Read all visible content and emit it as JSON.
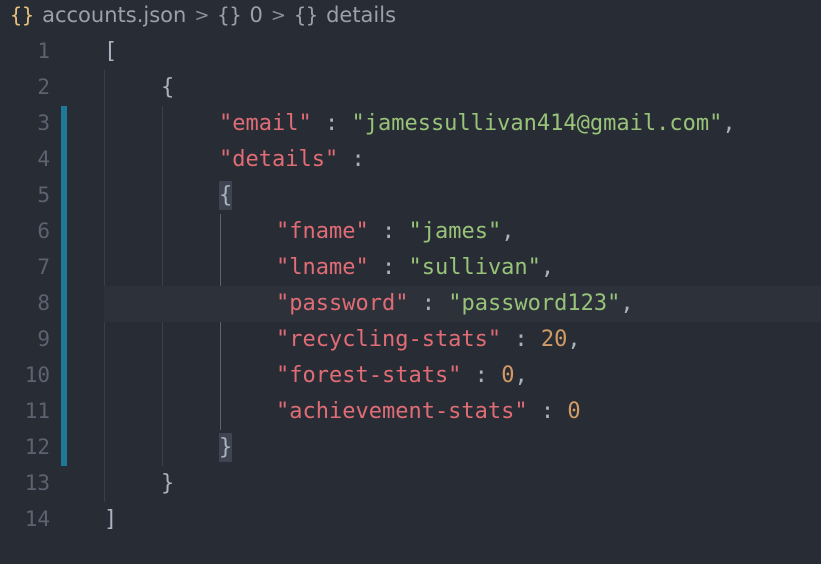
{
  "breadcrumb": {
    "file_icon": "{}",
    "file_name": "accounts.json",
    "sep1": ">",
    "seg1_icon": "{}",
    "seg1_label": "0",
    "sep2": ">",
    "seg2_icon": "{}",
    "seg2_label": "details"
  },
  "editor": {
    "lines": [
      {
        "num": "1"
      },
      {
        "num": "2"
      },
      {
        "num": "3"
      },
      {
        "num": "4"
      },
      {
        "num": "5"
      },
      {
        "num": "6"
      },
      {
        "num": "7"
      },
      {
        "num": "8"
      },
      {
        "num": "9"
      },
      {
        "num": "10"
      },
      {
        "num": "11"
      },
      {
        "num": "12"
      },
      {
        "num": "13"
      },
      {
        "num": "14"
      }
    ],
    "tokens": {
      "l1_open": "[",
      "l2_open": "{",
      "l3_key": "\"email\"",
      "l3_colon": " : ",
      "l3_val": "\"jamessullivan414@gmail.com\"",
      "l3_comma": ",",
      "l4_key": "\"details\"",
      "l4_colon": " :",
      "l5_open": "{",
      "l6_key": "\"fname\"",
      "l6_colon": " : ",
      "l6_val": "\"james\"",
      "l6_comma": ",",
      "l7_key": "\"lname\"",
      "l7_colon": " : ",
      "l7_val": "\"sullivan\"",
      "l7_comma": ",",
      "l8_key": "\"password\"",
      "l8_colon": " : ",
      "l8_val": "\"password123\"",
      "l8_comma": ",",
      "l9_key": "\"recycling-stats\"",
      "l9_colon": " : ",
      "l9_val": "20",
      "l9_comma": ",",
      "l10_key": "\"forest-stats\"",
      "l10_colon": " : ",
      "l10_val": "0",
      "l10_comma": ",",
      "l11_key": "\"achievement-stats\"",
      "l11_colon": " : ",
      "l11_val": "0",
      "l12_close": "}",
      "l13_close": "}",
      "l14_close": "]"
    }
  },
  "colors": {
    "background": "#282c34",
    "key": "#e06c75",
    "string": "#98c379",
    "number": "#d19a66",
    "gutter_modified": "#1f7897"
  }
}
